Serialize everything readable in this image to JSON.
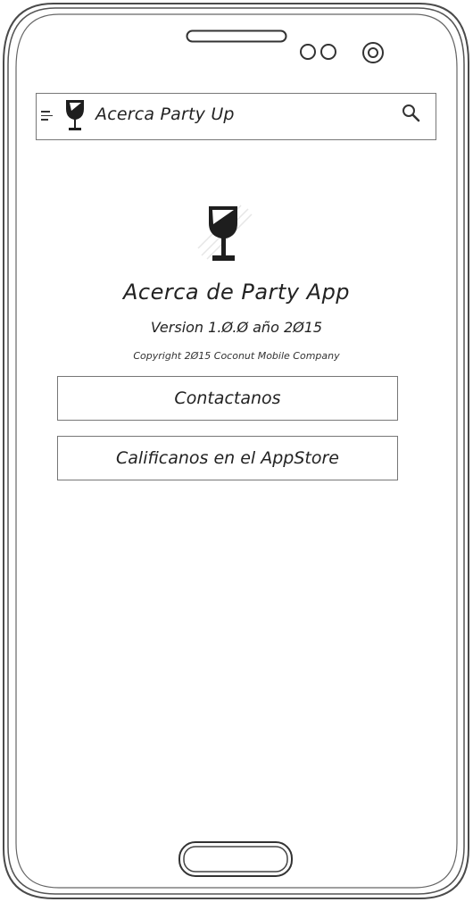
{
  "app_bar": {
    "menu_icon": "hamburger-menu-icon",
    "logo_icon": "wine-glass-logo-icon",
    "title": "Acerca Party Up",
    "search_icon": "search-icon"
  },
  "about": {
    "logo_icon": "wine-glass-logo-icon",
    "title": "Acerca de Party App",
    "version": "Version 1.Ø.Ø año 2Ø15",
    "copyright": "Copyright 2Ø15 Coconut Mobile Company"
  },
  "buttons": {
    "contact_label": "Contactanos",
    "rate_label": "Calificanos en el AppStore"
  },
  "colors": {
    "ink": "#222222",
    "border": "#777777",
    "background": "#ffffff"
  }
}
